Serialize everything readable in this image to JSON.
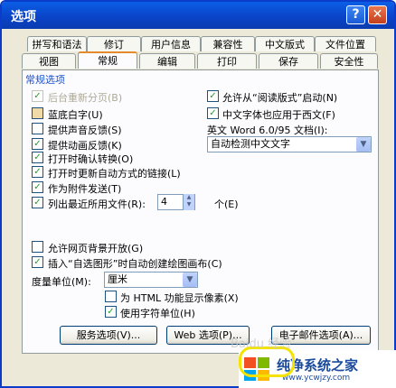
{
  "window": {
    "title": "选项",
    "help_label": "?",
    "close_label": "✕"
  },
  "tabs_row1": [
    "拼写和语法",
    "修订",
    "用户信息",
    "兼容性",
    "中文版式",
    "文件位置"
  ],
  "tabs_row2": [
    "视图",
    "常规",
    "编辑",
    "打印",
    "保存",
    "安全性"
  ],
  "section": "常规选项",
  "left_options": [
    {
      "label": "后台重新分页(B)",
      "checked": true,
      "disabled": true
    },
    {
      "label": "蓝底白字(U)",
      "checked": false,
      "disabled": false
    },
    {
      "label": "提供声音反馈(S)",
      "checked": false,
      "disabled": false
    },
    {
      "label": "提供动画反馈(K)",
      "checked": true,
      "disabled": false
    },
    {
      "label": "打开时确认转换(O)",
      "checked": true,
      "disabled": false
    },
    {
      "label": "打开时更新自动方式的链接(L)",
      "checked": true,
      "disabled": false
    },
    {
      "label": "作为附件发送(T)",
      "checked": true,
      "disabled": false
    },
    {
      "label": "列出最近所用文件(R):",
      "checked": true,
      "disabled": false
    }
  ],
  "right_options": [
    {
      "label": "允许从“阅读版式”启动(N)",
      "checked": true
    },
    {
      "label": "中文字体也应用于西文(F)",
      "checked": true
    }
  ],
  "word_doc_label": "英文 Word 6.0/95 文档(I):",
  "word_doc_value": "自动检测中文文字",
  "recent_count": "4",
  "recent_unit": "个(E)",
  "bottom_options": [
    {
      "label": "允许网页背景开放(G)",
      "checked": false
    },
    {
      "label": "插入“自选图形”时自动创建绘图画布(C)",
      "checked": true
    }
  ],
  "measure_label": "度量单位(M):",
  "measure_value": "厘米",
  "sub_options": [
    {
      "label": "为 HTML 功能显示像素(X)",
      "checked": false
    },
    {
      "label": "使用字符单位(H)",
      "checked": true
    }
  ],
  "buttons": [
    "服务选项(V)...",
    "Web 选项(P)...",
    "电子邮件选项(A)..."
  ],
  "watermark": {
    "title": "纯净系统之家",
    "url": "www.ycwjzy.com",
    "baidu": "Baidu 经验"
  }
}
